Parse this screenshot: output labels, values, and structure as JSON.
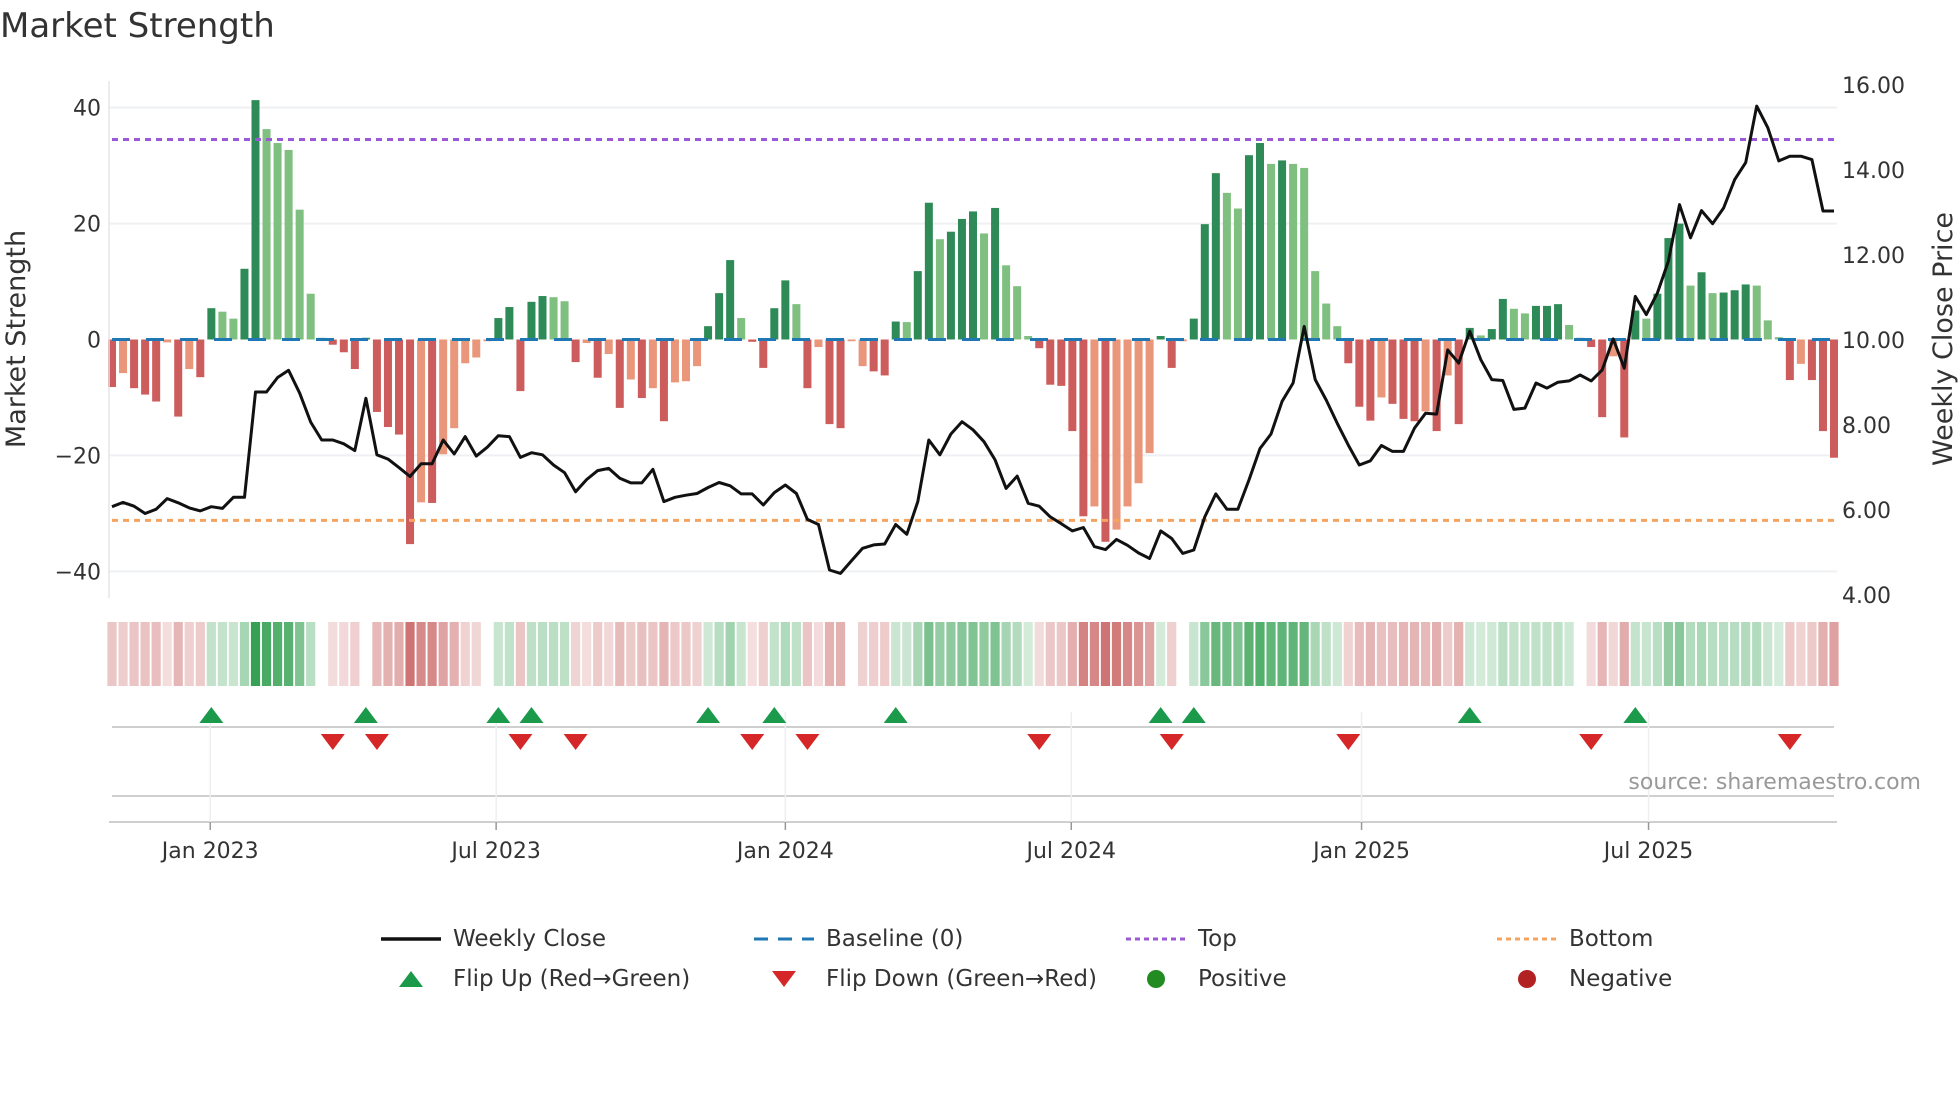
{
  "title": "Market Strength",
  "source": "source: sharemaestro.com",
  "colors": {
    "bar_pos_dark": "#2e8b57",
    "bar_pos_light": "#7fbf7f",
    "bar_neg_dark": "#cd5c5c",
    "bar_neg_light": "#e9967a",
    "close_line": "#111111",
    "baseline": "#1f77b4",
    "top_line": "#9b59d6",
    "bottom_line": "#f4a460",
    "flip_up": "#1a9a4a",
    "flip_down": "#d62728",
    "positive": "#228b22",
    "negative": "#b22222",
    "grid": "#eef0f3"
  },
  "legend": [
    {
      "key": "close",
      "label": "Weekly Close"
    },
    {
      "key": "baseline",
      "label": "Baseline (0)"
    },
    {
      "key": "top",
      "label": "Top"
    },
    {
      "key": "bottom",
      "label": "Bottom"
    },
    {
      "key": "flip_up",
      "label": "Flip Up (Red→Green)"
    },
    {
      "key": "flip_down",
      "label": "Flip Down (Green→Red)"
    },
    {
      "key": "positive",
      "label": "Positive"
    },
    {
      "key": "negative",
      "label": "Negative"
    }
  ],
  "chart_data": {
    "type": "bar",
    "title": "Market Strength",
    "ylabel": "Market Strength",
    "y2label": "Weekly Close Price",
    "xlabel": "",
    "ylim": [
      -44.6,
      44.6
    ],
    "y2lim": [
      3.93,
      16.1
    ],
    "yticks": [
      40,
      20,
      0,
      -20,
      -40
    ],
    "ytick_labels": [
      "40",
      "20",
      "0",
      "−20",
      "−40"
    ],
    "y2ticks": [
      16,
      14,
      12,
      10,
      8,
      6,
      4
    ],
    "y2tick_labels": [
      "16.00",
      "14.00",
      "12.00",
      "10.00",
      "8.00",
      "6.00",
      "4.00"
    ],
    "x_unit": "week index",
    "xticks": [
      {
        "at": 8.9,
        "label": "Jan 2023"
      },
      {
        "at": 34.8,
        "label": "Jul 2023"
      },
      {
        "at": 61.0,
        "label": "Jan 2024"
      },
      {
        "at": 86.9,
        "label": "Jul 2024"
      },
      {
        "at": 113.2,
        "label": "Jan 2025"
      },
      {
        "at": 139.2,
        "label": "Jul 2025"
      }
    ],
    "top_level": 34.5,
    "bottom_level": -31.2,
    "baseline": 0,
    "grid": true,
    "legend_position": "bottom",
    "strength": [
      -8.2,
      -5.8,
      -8.4,
      -9.5,
      -10.7,
      -0.5,
      -13.3,
      -5.1,
      -6.5,
      5.4,
      4.8,
      3.6,
      12.2,
      41.3,
      36.3,
      33.9,
      32.7,
      22.4,
      7.9,
      0.3,
      -0.9,
      -2.2,
      -5.1,
      0.3,
      -12.5,
      -15.1,
      -16.4,
      -35.3,
      -28.1,
      -28.2,
      -19.8,
      -15.3,
      -4.1,
      -3.1,
      -0.3,
      3.7,
      5.6,
      -8.9,
      6.5,
      7.5,
      7.3,
      6.6,
      -3.9,
      -0.6,
      -6.6,
      -2.5,
      -11.8,
      -6.9,
      -10.1,
      -8.4,
      -14.1,
      -7.4,
      -7.2,
      -4.6,
      2.3,
      8.0,
      13.7,
      3.7,
      -0.4,
      -4.9,
      5.4,
      10.2,
      6.1,
      -8.4,
      -1.3,
      -14.6,
      -15.3,
      -0.3,
      -4.6,
      -5.5,
      -6.2,
      3.1,
      3.0,
      11.8,
      23.6,
      17.3,
      18.6,
      20.8,
      22.1,
      18.3,
      22.7,
      12.8,
      9.2,
      0.6,
      -1.5,
      -7.8,
      -8.0,
      -15.8,
      -30.5,
      -28.8,
      -34.9,
      -32.8,
      -28.8,
      -24.8,
      -19.6,
      0.6,
      -4.9,
      -0.3,
      3.6,
      19.9,
      28.7,
      25.3,
      22.6,
      31.8,
      33.9,
      30.3,
      30.9,
      30.3,
      29.6,
      11.8,
      6.2,
      2.3,
      -4.1,
      -11.6,
      -14.0,
      -10.0,
      -11.1,
      -13.7,
      -14.1,
      -12.4,
      -15.8,
      -6.2,
      -14.6,
      2.0,
      0.7,
      1.8,
      7.0,
      5.3,
      4.5,
      5.8,
      5.8,
      6.1,
      2.5,
      0.3,
      -1.3,
      -13.4,
      -2.9,
      -16.9,
      5.0,
      3.6,
      7.9,
      17.5,
      20.0,
      9.3,
      11.6,
      8.0,
      8.1,
      8.5,
      9.5,
      9.3,
      3.3,
      0.4,
      -7.0,
      -4.2,
      -7.0,
      -15.8,
      -20.4
    ],
    "shade": "DLDDDLDLDDLLDDLLLLLLDDDDDDDDLDLLLLLDDDDDLLDLDLDLDLDLLLDDDLDDDDLDLDDLLDDDLDDLDDDLDLLLDDDDDLDLLLLDDLDDDLLDDLDLLLLLDDDLDDDLDLDDLDDLLDDDLLDDLDDLDDDLDLDDDLLLDLDDD",
    "weekly_close": [
      6.08,
      6.18,
      6.09,
      5.92,
      6.02,
      6.27,
      6.17,
      6.05,
      5.98,
      6.08,
      6.04,
      6.3,
      6.3,
      8.78,
      8.78,
      9.12,
      9.29,
      8.75,
      8.07,
      7.65,
      7.65,
      7.56,
      7.4,
      8.63,
      7.3,
      7.2,
      7.0,
      6.79,
      7.09,
      7.09,
      7.65,
      7.32,
      7.73,
      7.27,
      7.48,
      7.75,
      7.73,
      7.24,
      7.35,
      7.3,
      7.06,
      6.88,
      6.43,
      6.72,
      6.93,
      6.98,
      6.75,
      6.64,
      6.64,
      6.96,
      6.2,
      6.3,
      6.35,
      6.39,
      6.53,
      6.65,
      6.57,
      6.38,
      6.38,
      6.12,
      6.41,
      6.59,
      6.39,
      5.78,
      5.66,
      4.59,
      4.51,
      4.81,
      5.1,
      5.18,
      5.2,
      5.66,
      5.43,
      6.2,
      7.65,
      7.3,
      7.79,
      8.08,
      7.89,
      7.61,
      7.18,
      6.51,
      6.8,
      6.16,
      6.09,
      5.84,
      5.68,
      5.51,
      5.59,
      5.14,
      5.07,
      5.31,
      5.17,
      4.99,
      4.86,
      5.51,
      5.33,
      4.98,
      5.06,
      5.84,
      6.38,
      6.02,
      6.02,
      6.71,
      7.45,
      7.79,
      8.56,
      8.99,
      10.32,
      9.07,
      8.59,
      8.04,
      7.53,
      7.06,
      7.16,
      7.52,
      7.38,
      7.38,
      7.93,
      8.28,
      8.26,
      9.77,
      9.46,
      10.21,
      9.54,
      9.07,
      9.05,
      8.37,
      8.4,
      8.99,
      8.87,
      9.01,
      9.04,
      9.18,
      9.04,
      9.3,
      10.03,
      9.34,
      11.03,
      10.6,
      11.11,
      11.86,
      13.19,
      12.41,
      13.05,
      12.74,
      13.11,
      13.78,
      14.18,
      15.51,
      15.0,
      14.22,
      14.33,
      14.33,
      14.25,
      13.04,
      13.04
    ]
  }
}
